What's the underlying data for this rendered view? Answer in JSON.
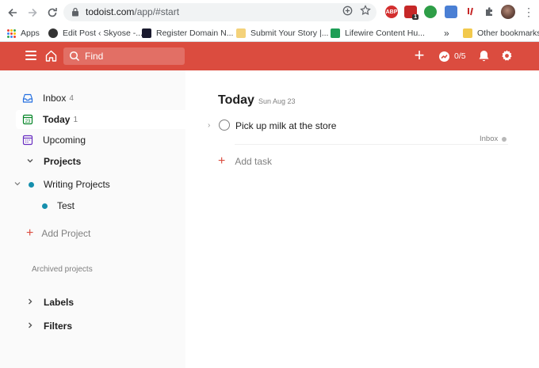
{
  "browser": {
    "url_host": "todoist.com",
    "url_path": "/app/#start",
    "extensions": [
      "ABP",
      "1"
    ]
  },
  "bookmarks": {
    "items": [
      {
        "label": "Apps"
      },
      {
        "label": "Edit Post ‹ Skyose -..."
      },
      {
        "label": "Register Domain N..."
      },
      {
        "label": "Submit Your Story |..."
      },
      {
        "label": "Lifewire Content Hu..."
      }
    ],
    "overflow": "»",
    "other": "Other bookmarks"
  },
  "header": {
    "search_placeholder": "Find",
    "karma": "0/5",
    "colors": {
      "brand": "#db4c3f"
    }
  },
  "sidebar": {
    "inbox": {
      "label": "Inbox",
      "count": "4"
    },
    "today": {
      "label": "Today",
      "count": "1"
    },
    "upcoming": {
      "label": "Upcoming"
    },
    "projects_header": "Projects",
    "projects": [
      {
        "label": "Writing Projects",
        "color": "#158fad"
      },
      {
        "label": "Test",
        "color": "#158fad"
      }
    ],
    "add_project": "Add Project",
    "archived": "Archived projects",
    "labels": "Labels",
    "filters": "Filters"
  },
  "main": {
    "title": "Today",
    "date": "Sun Aug 23",
    "tasks": [
      {
        "text": "Pick up milk at the store",
        "project": "Inbox"
      }
    ],
    "add_task": "Add task"
  }
}
